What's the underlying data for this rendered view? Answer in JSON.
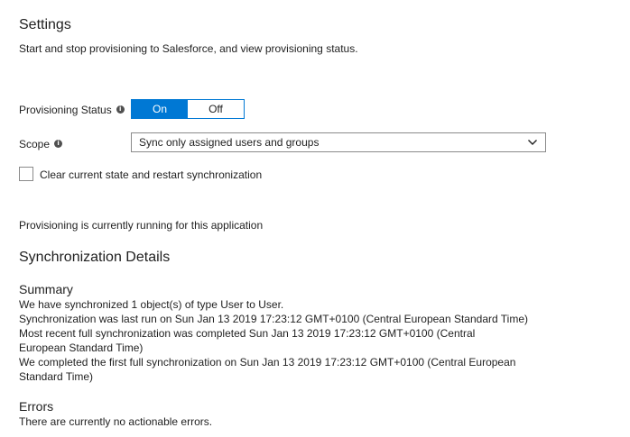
{
  "settings": {
    "title": "Settings",
    "description": "Start and stop provisioning to Salesforce, and view provisioning status."
  },
  "provisioning_status": {
    "label": "Provisioning Status",
    "on_label": "On",
    "off_label": "Off",
    "selected": "On"
  },
  "scope": {
    "label": "Scope",
    "value": "Sync only assigned users and groups"
  },
  "restart": {
    "label": "Clear current state and restart synchronization",
    "checked": false
  },
  "running_message": "Provisioning is currently running for this application",
  "sync_details": {
    "title": "Synchronization Details",
    "summary_title": "Summary",
    "summary_lines": [
      "We have synchronized 1 object(s) of type User to User.",
      "Synchronization was last run on Sun Jan 13 2019 17:23:12 GMT+0100 (Central European Standard Time)",
      "Most recent full synchronization was completed Sun Jan 13 2019 17:23:12 GMT+0100 (Central European Standard Time)",
      "We completed the first full synchronization on Sun Jan 13 2019 17:23:12 GMT+0100 (Central European Standard Time)"
    ],
    "errors_title": "Errors",
    "errors_text": "There are currently no actionable errors."
  },
  "colors": {
    "accent": "#0078d4",
    "text": "#1f1f1f",
    "border": "#8a8a8a",
    "info_icon": "#505050"
  },
  "icons": {
    "info": "info-icon",
    "dropdown": "chevron-down-icon"
  }
}
